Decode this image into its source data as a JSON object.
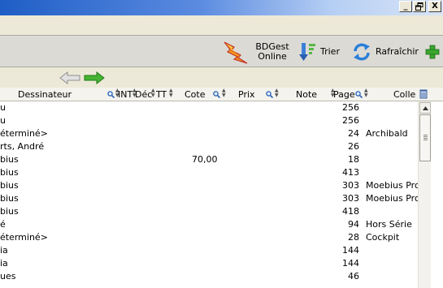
{
  "window": {
    "buttons": [
      "_",
      "🗗",
      "X"
    ]
  },
  "toolbar": {
    "bdgest_label": "BDGest Online",
    "sort_label": "Trier",
    "refresh_label": "Rafraîchir"
  },
  "grid": {
    "headers": {
      "dessinateur": "Dessinateur",
      "int": "INT",
      "dec": "Déc",
      "tt": "TT",
      "cote": "Cote",
      "prix": "Prix",
      "note": "Note",
      "page": "Page",
      "collection": "Colle"
    },
    "rows": [
      {
        "dessinateur": "u",
        "cote": "",
        "page": "256",
        "collection": ""
      },
      {
        "dessinateur": "u",
        "cote": "",
        "page": "256",
        "collection": ""
      },
      {
        "dessinateur": "éterminé>",
        "cote": "",
        "page": "24",
        "collection": "Archibald"
      },
      {
        "dessinateur": "rts, André",
        "cote": "",
        "page": "26",
        "collection": ""
      },
      {
        "dessinateur": "bius",
        "cote": "70,00",
        "page": "18",
        "collection": ""
      },
      {
        "dessinateur": "bius",
        "cote": "",
        "page": "413",
        "collection": ""
      },
      {
        "dessinateur": "bius",
        "cote": "",
        "page": "303",
        "collection": "Moebius Pro"
      },
      {
        "dessinateur": "bius",
        "cote": "",
        "page": "303",
        "collection": "Moebius Pro"
      },
      {
        "dessinateur": "bius",
        "cote": "",
        "page": "418",
        "collection": ""
      },
      {
        "dessinateur": "é",
        "cote": "",
        "page": "94",
        "collection": "Hors Série"
      },
      {
        "dessinateur": "éterminé>",
        "cote": "",
        "page": "28",
        "collection": "Cockpit"
      },
      {
        "dessinateur": "ia",
        "cote": "",
        "page": "144",
        "collection": ""
      },
      {
        "dessinateur": "ia",
        "cote": "",
        "page": "144",
        "collection": ""
      },
      {
        "dessinateur": "ues",
        "cote": "",
        "page": "46",
        "collection": ""
      }
    ]
  }
}
